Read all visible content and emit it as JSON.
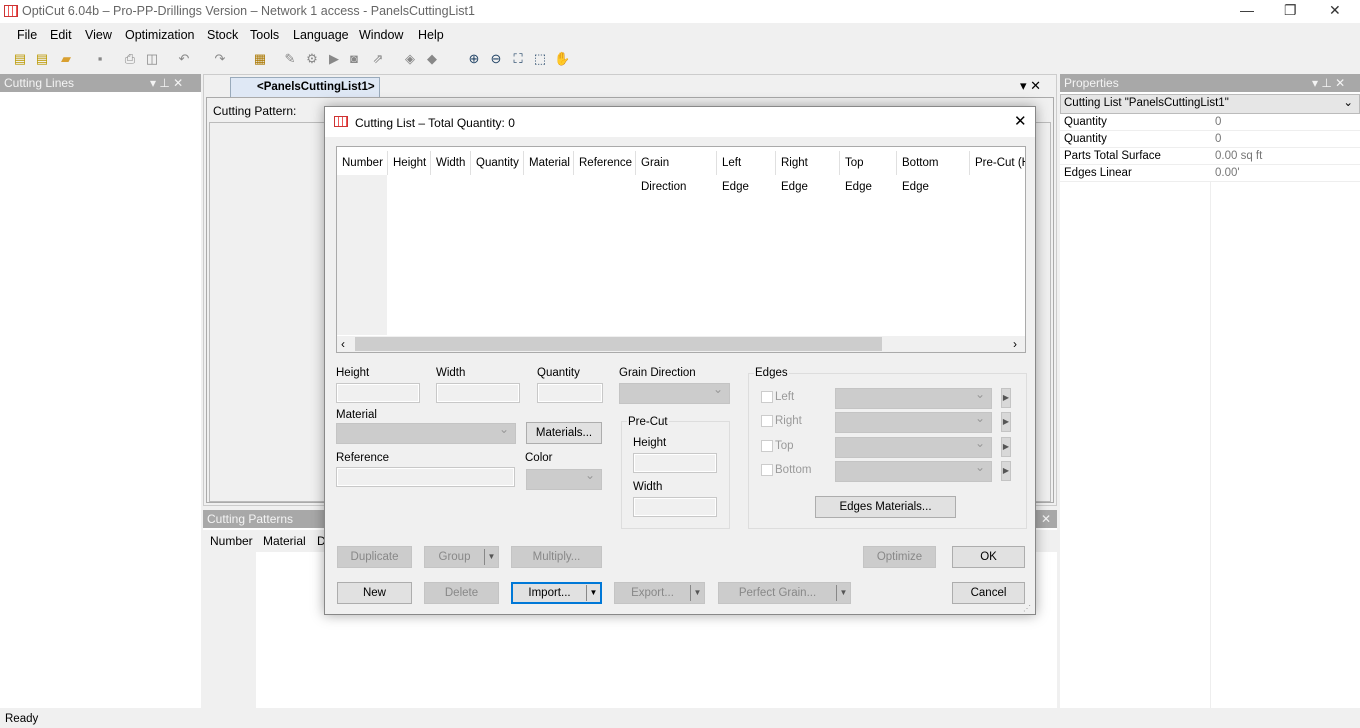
{
  "app": {
    "title": "OptiCut 6.04b – Pro-PP-Drillings Version – Network 1 access - PanelsCuttingList1",
    "status": "Ready"
  },
  "menu": [
    "File",
    "Edit",
    "View",
    "Optimization",
    "Stock",
    "Tools",
    "Language",
    "Window",
    "Help"
  ],
  "toolbar_icons": [
    "new-icon",
    "new-list-icon",
    "open-icon",
    "save-icon",
    "print-icon",
    "print-preview-icon",
    "undo-icon",
    "redo-icon",
    "properties-icon",
    "edit-icon",
    "settings-icon",
    "run-icon",
    "report-icon",
    "export-icon",
    "stock-icon",
    "layers-icon",
    "zoom-in-icon",
    "zoom-out-icon",
    "zoom-fit-icon",
    "zoom-window-icon",
    "pan-hand-icon"
  ],
  "left_panel": {
    "title": "Cutting Lines"
  },
  "document": {
    "tab": "<PanelsCuttingList1>",
    "cutting_pattern_label": "Cutting Pattern:"
  },
  "cutting_patterns": {
    "title": "Cutting Patterns",
    "columns": [
      "Number",
      "Material",
      "D"
    ]
  },
  "properties": {
    "title": "Properties",
    "selector": "Cutting List \"PanelsCuttingList1\"",
    "rows": [
      {
        "name": "Quantity",
        "value": "0"
      },
      {
        "name": "Quantity",
        "value": "0"
      },
      {
        "name": "Parts Total Surface",
        "value": "0.00 sq ft"
      },
      {
        "name": "Edges Linear",
        "value": "0.00'"
      }
    ]
  },
  "dialog": {
    "title": "Cutting List – Total Quantity: 0",
    "columns": [
      "Number",
      "Height",
      "Width",
      "Quantity",
      "Material",
      "Reference",
      "Grain Direction",
      "Left Edge",
      "Right Edge",
      "Top Edge",
      "Bottom Edge",
      "Pre-Cut (H"
    ],
    "labels": {
      "height": "Height",
      "width": "Width",
      "quantity": "Quantity",
      "grain": "Grain Direction",
      "material": "Material",
      "reference": "Reference",
      "color": "Color",
      "precut": "Pre-Cut",
      "precut_height": "Height",
      "precut_width": "Width",
      "edges": "Edges"
    },
    "edges": [
      "Left",
      "Right",
      "Top",
      "Bottom"
    ],
    "buttons": {
      "materials": "Materials...",
      "edges_materials": "Edges Materials...",
      "duplicate": "Duplicate",
      "group": "Group",
      "multiply": "Multiply...",
      "optimize": "Optimize",
      "ok": "OK",
      "new": "New",
      "delete": "Delete",
      "import": "Import...",
      "export": "Export...",
      "perfect_grain": "Perfect Grain...",
      "cancel": "Cancel"
    }
  }
}
